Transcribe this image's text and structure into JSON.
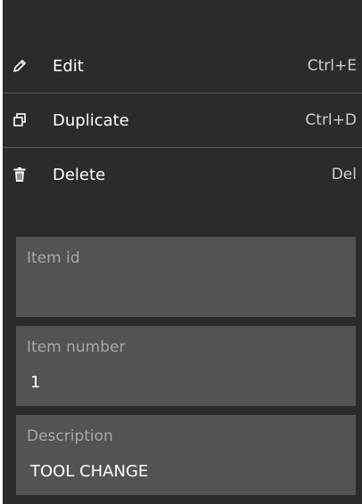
{
  "menu": {
    "items": [
      {
        "label": "Edit",
        "shortcut": "Ctrl+E",
        "icon": "pencil-icon"
      },
      {
        "label": "Duplicate",
        "shortcut": "Ctrl+D",
        "icon": "duplicate-icon"
      },
      {
        "label": "Delete",
        "shortcut": "Del",
        "icon": "trash-icon"
      }
    ]
  },
  "form": {
    "item_id": {
      "label": "Item id",
      "value": ""
    },
    "item_number": {
      "label": "Item number",
      "value": "1"
    },
    "description": {
      "label": "Description",
      "value": "TOOL CHANGE"
    }
  },
  "colors": {
    "panel_bg": "#2b2b2b",
    "field_bg": "#535353",
    "separator": "#5a5a5a",
    "label_text": "#a7a7a7"
  }
}
